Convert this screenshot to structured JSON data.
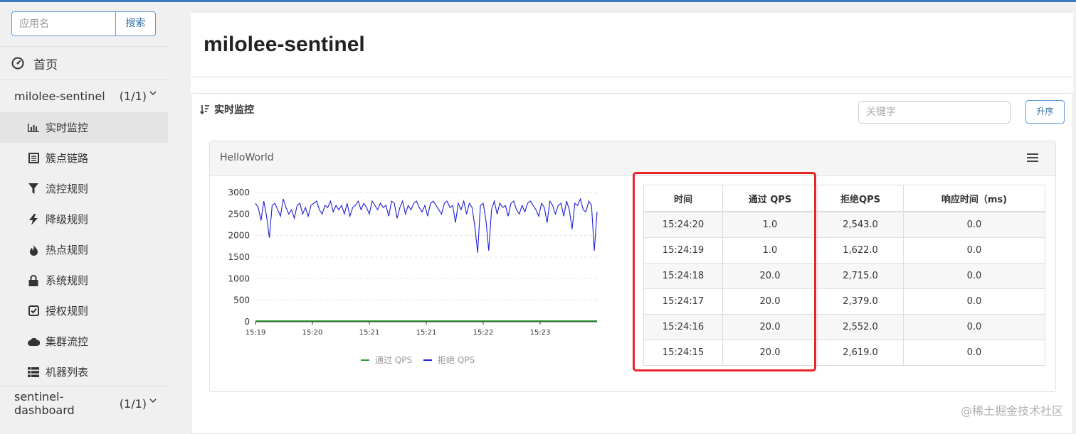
{
  "sidebar": {
    "search": {
      "placeholder": "应用名",
      "button_label": "搜索"
    },
    "home_label": "首页",
    "apps": [
      {
        "name": "milolee-sentinel",
        "count": "(1/1)",
        "expanded": true
      },
      {
        "name": "sentinel-dashboard",
        "count": "(1/1)",
        "expanded": false
      }
    ],
    "menu": [
      {
        "label": "实时监控",
        "icon": "bar-chart-icon",
        "active": true
      },
      {
        "label": "簇点链路",
        "icon": "list-icon"
      },
      {
        "label": "流控规则",
        "icon": "filter-icon"
      },
      {
        "label": "降级规则",
        "icon": "flash-icon"
      },
      {
        "label": "热点规则",
        "icon": "fire-icon"
      },
      {
        "label": "系统规则",
        "icon": "lock-icon"
      },
      {
        "label": "授权规则",
        "icon": "check-square-icon"
      },
      {
        "label": "集群流控",
        "icon": "cloud-icon"
      },
      {
        "label": "机器列表",
        "icon": "th-list-icon"
      }
    ]
  },
  "main": {
    "title": "milolee-sentinel",
    "panel_title": "实时监控",
    "keyword_placeholder": "关键字",
    "sort_button": "升序",
    "resource": {
      "name": "HelloWorld",
      "table": {
        "headers": [
          "时间",
          "通过 QPS",
          "拒绝QPS",
          "响应时间（ms)"
        ],
        "rows": [
          [
            "15:24:20",
            "1.0",
            "2,543.0",
            "0.0"
          ],
          [
            "15:24:19",
            "1.0",
            "1,622.0",
            "0.0"
          ],
          [
            "15:24:18",
            "20.0",
            "2,715.0",
            "0.0"
          ],
          [
            "15:24:17",
            "20.0",
            "2,379.0",
            "0.0"
          ],
          [
            "15:24:16",
            "20.0",
            "2,552.0",
            "0.0"
          ],
          [
            "15:24:15",
            "20.0",
            "2,619.0",
            "0.0"
          ]
        ]
      }
    }
  },
  "chart_data": {
    "type": "line",
    "ylim": [
      0,
      3000
    ],
    "yticks": [
      "3000",
      "2500",
      "2000",
      "1500",
      "1000",
      "500",
      "0"
    ],
    "xticks": [
      "15:19",
      "15:20",
      "15:21",
      "15:21",
      "15:22",
      "15:23"
    ],
    "series": [
      {
        "name": "通过 QPS",
        "color": "#2ca02c",
        "values": [
          20,
          20,
          20,
          20,
          20,
          20,
          20,
          20,
          20,
          20,
          20,
          20,
          20,
          20,
          20,
          20,
          20,
          20,
          20,
          20,
          20,
          20,
          20,
          20,
          20,
          20,
          20,
          20,
          20,
          20
        ]
      },
      {
        "name": "拒绝 QPS",
        "color": "#1f1fd6",
        "values": [
          2750,
          2650,
          2350,
          2800,
          2450,
          1950,
          2700,
          2750,
          2600,
          2450,
          2850,
          2650,
          2500,
          2600,
          2400,
          2700,
          2750,
          2500,
          2650,
          2450,
          2700,
          2750,
          2800,
          2600,
          2500,
          2700,
          2650,
          2800,
          2550,
          2700,
          2600,
          2700,
          2500,
          2750,
          2450,
          2650,
          2700,
          2800,
          2600,
          2750,
          2650,
          2500,
          2800,
          2700,
          2600,
          2750,
          2650,
          2700,
          2450,
          2800,
          2750,
          2400,
          2650,
          2800,
          2500,
          2700,
          2600,
          2750,
          2800,
          2650,
          2550,
          2700,
          2450,
          2750,
          2800,
          2700,
          2600,
          2500,
          2750,
          2800,
          2650,
          2700,
          2300,
          2750,
          2600,
          2800,
          2500,
          2750,
          2650,
          2200,
          1600,
          2700,
          2750,
          2350,
          1650,
          2600,
          2800,
          2500,
          2750,
          2650,
          2700,
          2450,
          2750,
          2800,
          2600,
          2500,
          2700,
          2550,
          2750,
          2800,
          2700,
          2600,
          2450,
          2750,
          2650,
          2300,
          2800,
          2700,
          2500,
          2700,
          2750,
          2450,
          2800,
          2600,
          2150,
          2750,
          2700,
          2850,
          2600,
          2550,
          2800,
          2700,
          1650,
          2550
        ]
      }
    ]
  },
  "watermark": "@稀土掘金技术社区",
  "colors": {
    "accent": "#3c7dbf",
    "highlight": "#e8262a",
    "pass_line": "#2ca02c",
    "block_line": "#1f1fd6"
  }
}
